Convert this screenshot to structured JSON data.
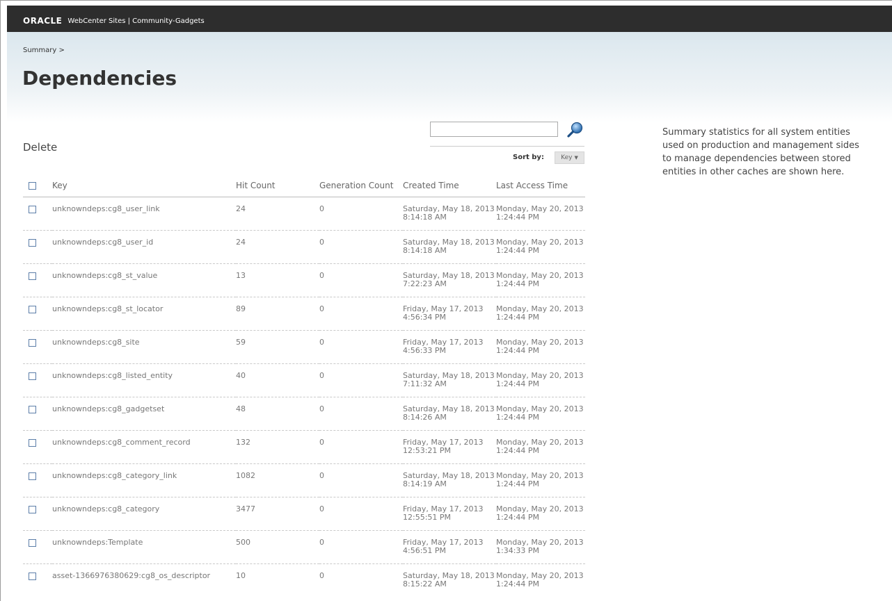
{
  "header": {
    "logo_text": "ORACLE",
    "app_title": "WebCenter Sites | Community-Gadgets"
  },
  "breadcrumb": "Summary >",
  "page_title": "Dependencies",
  "actions": {
    "delete_label": "Delete"
  },
  "search": {
    "value": "",
    "placeholder": ""
  },
  "sort": {
    "label": "Sort by:",
    "selected": "Key"
  },
  "table": {
    "columns": [
      "Key",
      "Hit Count",
      "Generation Count",
      "Created Time",
      "Last Access Time"
    ],
    "rows": [
      {
        "key": "unknowndeps:cg8_user_link",
        "hit": "24",
        "gen": "0",
        "created": "Saturday, May 18, 2013 8:14:18 AM",
        "last": "Monday, May 20, 2013 1:24:44 PM"
      },
      {
        "key": "unknowndeps:cg8_user_id",
        "hit": "24",
        "gen": "0",
        "created": "Saturday, May 18, 2013 8:14:18 AM",
        "last": "Monday, May 20, 2013 1:24:44 PM"
      },
      {
        "key": "unknowndeps:cg8_st_value",
        "hit": "13",
        "gen": "0",
        "created": "Saturday, May 18, 2013 7:22:23 AM",
        "last": "Monday, May 20, 2013 1:24:44 PM"
      },
      {
        "key": "unknowndeps:cg8_st_locator",
        "hit": "89",
        "gen": "0",
        "created": "Friday, May 17, 2013 4:56:34 PM",
        "last": "Monday, May 20, 2013 1:24:44 PM"
      },
      {
        "key": "unknowndeps:cg8_site",
        "hit": "59",
        "gen": "0",
        "created": "Friday, May 17, 2013 4:56:33 PM",
        "last": "Monday, May 20, 2013 1:24:44 PM"
      },
      {
        "key": "unknowndeps:cg8_listed_entity",
        "hit": "40",
        "gen": "0",
        "created": "Saturday, May 18, 2013 7:11:32 AM",
        "last": "Monday, May 20, 2013 1:24:44 PM"
      },
      {
        "key": "unknowndeps:cg8_gadgetset",
        "hit": "48",
        "gen": "0",
        "created": "Saturday, May 18, 2013 8:14:26 AM",
        "last": "Monday, May 20, 2013 1:24:44 PM"
      },
      {
        "key": "unknowndeps:cg8_comment_record",
        "hit": "132",
        "gen": "0",
        "created": "Friday, May 17, 2013 12:53:21 PM",
        "last": "Monday, May 20, 2013 1:24:44 PM"
      },
      {
        "key": "unknowndeps:cg8_category_link",
        "hit": "1082",
        "gen": "0",
        "created": "Saturday, May 18, 2013 8:14:19 AM",
        "last": "Monday, May 20, 2013 1:24:44 PM"
      },
      {
        "key": "unknowndeps:cg8_category",
        "hit": "3477",
        "gen": "0",
        "created": "Friday, May 17, 2013 12:55:51 PM",
        "last": "Monday, May 20, 2013 1:24:44 PM"
      },
      {
        "key": "unknowndeps:Template",
        "hit": "500",
        "gen": "0",
        "created": "Friday, May 17, 2013 4:56:51 PM",
        "last": "Monday, May 20, 2013 1:34:33 PM"
      },
      {
        "key": "asset-1366976380629:cg8_os_descriptor",
        "hit": "10",
        "gen": "0",
        "created": "Saturday, May 18, 2013 8:15:22 AM",
        "last": "Monday, May 20, 2013 1:24:44 PM"
      }
    ]
  },
  "sidebar": {
    "description": "Summary statistics for all system entities used on production and management sides to manage dependencies between stored entities in other caches are shown here."
  },
  "colors": {
    "topbar": "#2d2d2d",
    "header_gradient_top": "#dbe7ee",
    "checkbox_border": "#5b7da8",
    "search_icon": "#2f6fb0"
  },
  "icons": {
    "search": "magnifier-icon",
    "sort_dropdown": "chevron-down-icon"
  }
}
